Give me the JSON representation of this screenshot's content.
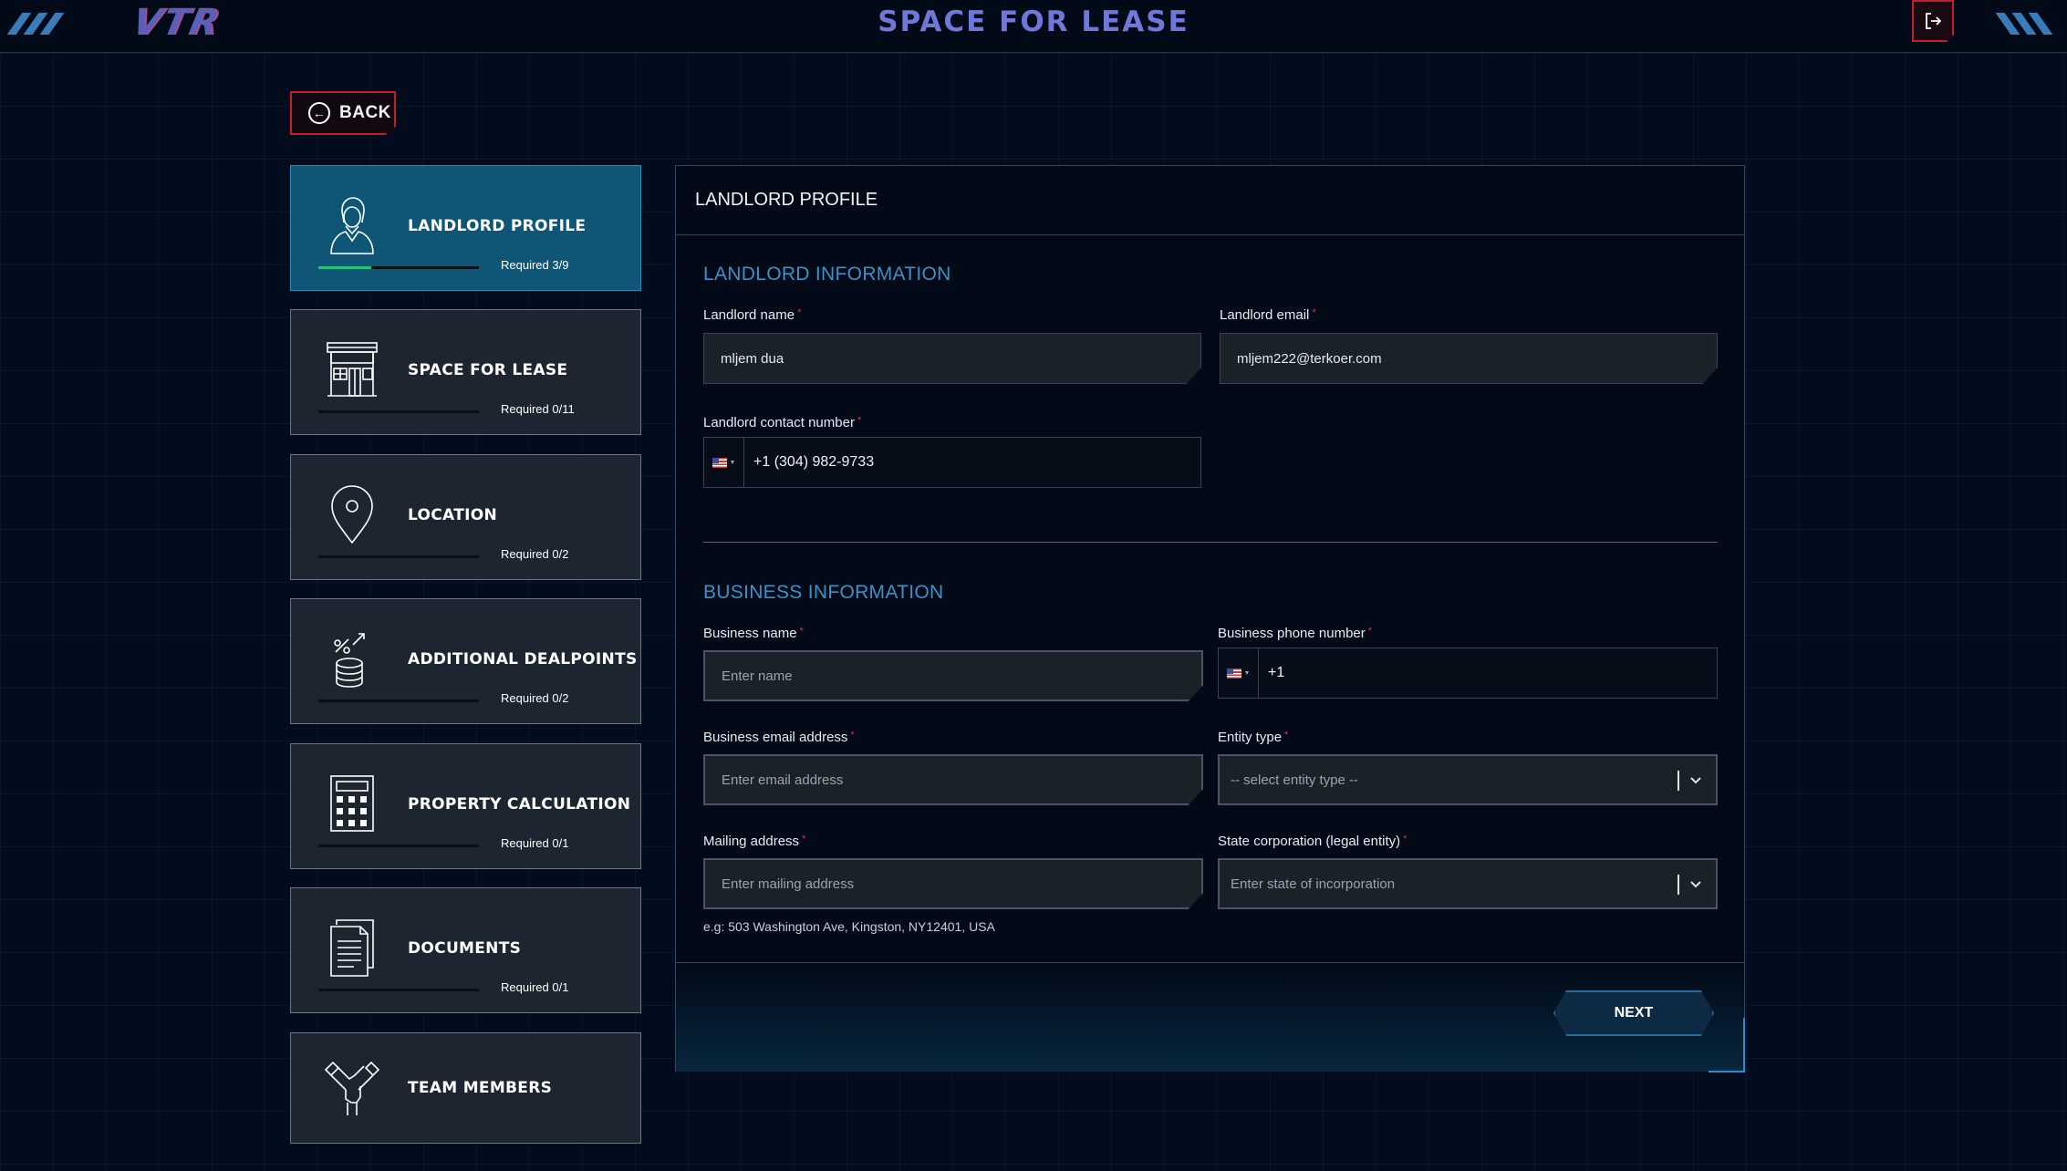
{
  "header": {
    "logo": "VTR",
    "title": "SPACE FOR LEASE"
  },
  "back_label": "BACK",
  "steps": [
    {
      "label": "LANDLORD PROFILE",
      "required": "Required 3/9",
      "progress": 0.33
    },
    {
      "label": "SPACE FOR LEASE",
      "required": "Required 0/11",
      "progress": 0
    },
    {
      "label": "LOCATION",
      "required": "Required 0/2",
      "progress": 0
    },
    {
      "label": "ADDITIONAL DEALPOINTS",
      "required": "Required 0/2",
      "progress": 0
    },
    {
      "label": "PROPERTY CALCULATION",
      "required": "Required 0/1",
      "progress": 0
    },
    {
      "label": "DOCUMENTS",
      "required": "Required 0/1",
      "progress": 0
    },
    {
      "label": "TEAM MEMBERS"
    }
  ],
  "panel": {
    "title": "LANDLORD PROFILE",
    "landlord_section": "LANDLORD INFORMATION",
    "landlord_name_label": "Landlord name",
    "landlord_name_value": "mljem dua",
    "landlord_email_label": "Landlord email",
    "landlord_email_value": "mljem222@terkoer.com",
    "landlord_phone_label": "Landlord contact number",
    "landlord_phone_value": "+1 (304) 982-9733",
    "business_section": "BUSINESS INFORMATION",
    "business_name_label": "Business name",
    "business_name_placeholder": "Enter name",
    "business_phone_label": "Business phone number",
    "business_phone_value": "+1",
    "business_email_label": "Business email address",
    "business_email_placeholder": "Enter email address",
    "entity_type_label": "Entity type",
    "entity_type_value": "-- select entity type --",
    "mailing_address_label": "Mailing address",
    "mailing_address_placeholder": "Enter mailing address",
    "mailing_address_hint": "e.g: 503 Washington Ave, Kingston, NY12401, USA",
    "state_corp_label": "State corporation (legal entity)",
    "state_corp_placeholder": "Enter state of incorporation",
    "next_label": "NEXT"
  },
  "colors": {
    "background": "#030c1c",
    "accent_blue": "#3a92c8",
    "active_step": "#0f5575",
    "danger_red": "#c0202c",
    "progress_green": "#1fc47a"
  },
  "icons": [
    "logout-icon",
    "back-arrow-icon",
    "user-icon",
    "building-icon",
    "location-pin-icon",
    "coins-icon",
    "calculator-icon",
    "document-icon",
    "handshake-icon",
    "chevron-down-icon",
    "us-flag-icon"
  ]
}
